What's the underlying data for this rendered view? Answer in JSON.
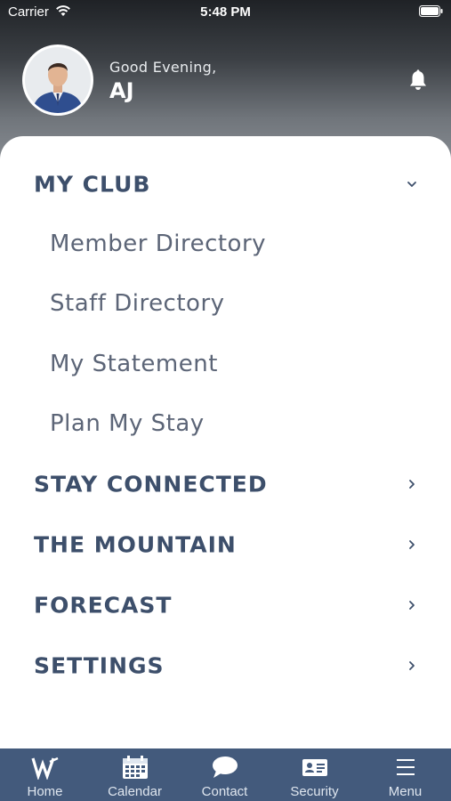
{
  "status_bar": {
    "carrier": "Carrier",
    "time": "5:48 PM"
  },
  "header": {
    "greeting": "Good Evening,",
    "user_name": "AJ"
  },
  "menu": {
    "sections": [
      {
        "label": "MY CLUB",
        "expanded": true,
        "items": [
          "Member Directory",
          "Staff Directory",
          "My Statement",
          "Plan My Stay"
        ]
      },
      {
        "label": "STAY CONNECTED",
        "expanded": false
      },
      {
        "label": "THE MOUNTAIN",
        "expanded": false
      },
      {
        "label": "FORECAST",
        "expanded": false
      },
      {
        "label": "SETTINGS",
        "expanded": false
      }
    ]
  },
  "tabbar": {
    "tabs": [
      {
        "label": "Home",
        "icon": "logo-w-icon"
      },
      {
        "label": "Calendar",
        "icon": "calendar-icon"
      },
      {
        "label": "Contact",
        "icon": "chat-bubble-icon"
      },
      {
        "label": "Security",
        "icon": "id-card-icon"
      },
      {
        "label": "Menu",
        "icon": "hamburger-icon"
      }
    ]
  },
  "colors": {
    "accent": "#3d4f6b",
    "tabbar": "#435a7c",
    "sub_item": "#5c6577"
  }
}
